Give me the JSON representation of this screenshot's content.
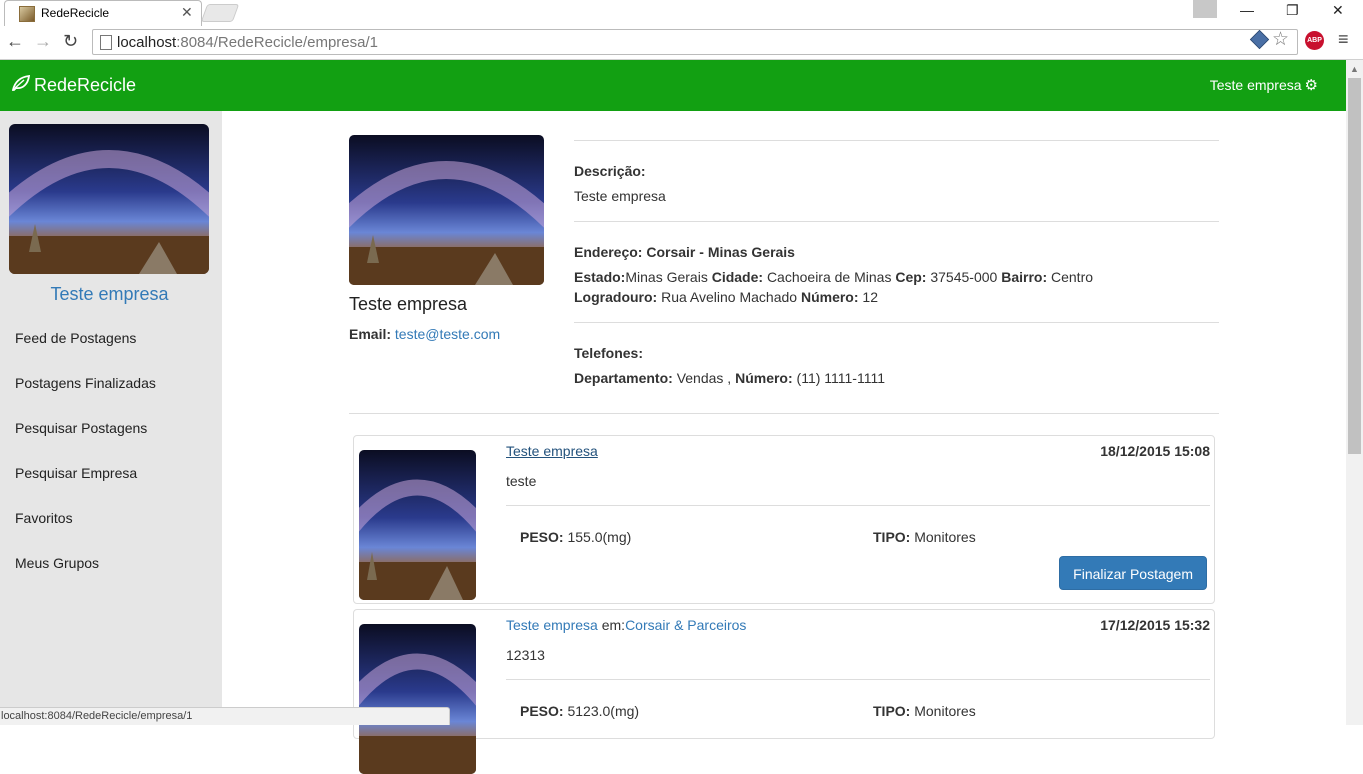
{
  "browser": {
    "tab_title": "RedeRecicle",
    "url_host": "localhost",
    "url_rest": ":8084/RedeRecicle/empresa/1",
    "window_controls": [
      "—",
      "❐",
      "✕"
    ],
    "status_url": "localhost:8084/RedeRecicle/empresa/1"
  },
  "navbar": {
    "brand": "RedeRecicle",
    "user": "Teste empresa"
  },
  "sidebar": {
    "name": "Teste empresa",
    "items": [
      {
        "label": "Feed de Postagens"
      },
      {
        "label": "Postagens Finalizadas"
      },
      {
        "label": "Pesquisar Postagens"
      },
      {
        "label": "Pesquisar Empresa"
      },
      {
        "label": "Favoritos"
      },
      {
        "label": "Meus Grupos"
      }
    ]
  },
  "profile": {
    "name": "Teste empresa",
    "email_label": "Email:",
    "email": "teste@teste.com",
    "descricao_label": "Descrição:",
    "descricao": "Teste empresa",
    "endereco_label": "Endereço:",
    "endereco": "Corsair - Minas Gerais",
    "estado_label": "Estado:",
    "estado": "Minas Gerais",
    "cidade_label": "Cidade:",
    "cidade": "Cachoeira de Minas",
    "cep_label": "Cep:",
    "cep": "37545-000",
    "bairro_label": "Bairro:",
    "bairro": "Centro",
    "logradouro_label": "Logradouro:",
    "logradouro": "Rua Avelino Machado",
    "numero_label": "Número:",
    "numero": "12",
    "telefones_label": "Telefones:",
    "departamento_label": "Departamento:",
    "departamento": "Vendas ,",
    "telefone_numero_label": "Número:",
    "telefone": "(11) 1111-1111"
  },
  "posts": [
    {
      "author": "Teste empresa",
      "group_prefix": "",
      "group": "",
      "date": "18/12/2015 15:08",
      "text": "teste",
      "peso_label": "PESO:",
      "peso": "155.0(mg)",
      "tipo_label": "TIPO:",
      "tipo": "Monitores",
      "button": "Finalizar Postagem"
    },
    {
      "author": "Teste empresa",
      "group_prefix": "em:",
      "group": "Corsair & Parceiros",
      "date": "17/12/2015 15:32",
      "text": "12313",
      "peso_label": "PESO:",
      "peso": "5123.0(mg)",
      "tipo_label": "TIPO:",
      "tipo": "Monitores"
    }
  ]
}
